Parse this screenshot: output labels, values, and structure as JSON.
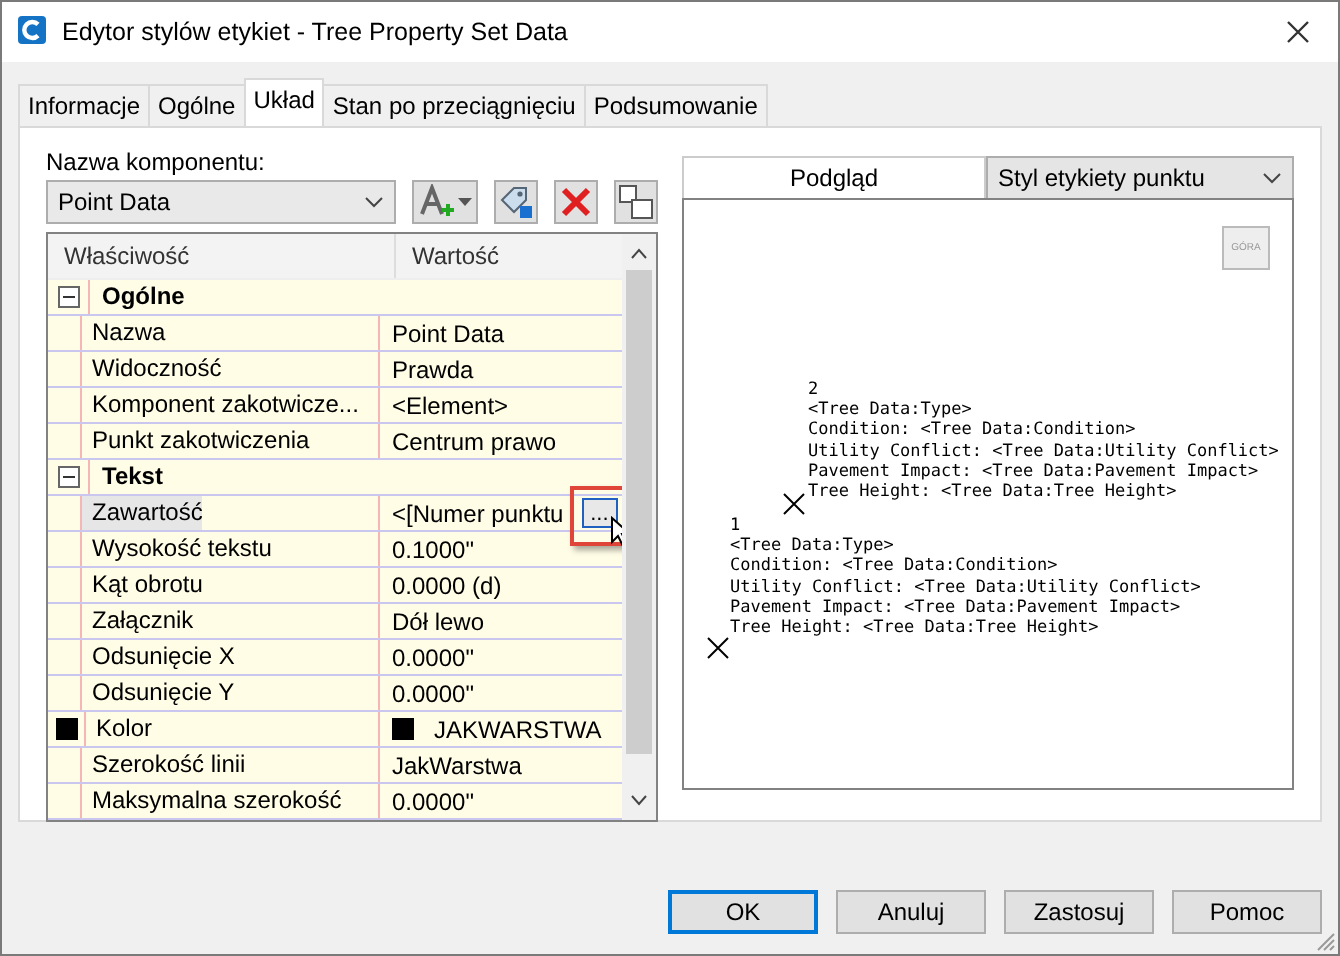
{
  "window": {
    "title": "Edytor stylów etykiet - Tree Property Set Data"
  },
  "tabs": [
    {
      "label": "Informacje",
      "selected": false
    },
    {
      "label": "Ogólne",
      "selected": false
    },
    {
      "label": "Układ",
      "selected": true
    },
    {
      "label": "Stan po przeciągnięciu",
      "selected": false
    },
    {
      "label": "Podsumowanie",
      "selected": false
    }
  ],
  "component": {
    "label": "Nazwa komponentu:",
    "value": "Point Data"
  },
  "grid": {
    "columns": [
      "Właściwość",
      "Wartość"
    ],
    "groups": [
      {
        "name": "Ogólne",
        "expanded": true,
        "rows": [
          {
            "name": "Nazwa",
            "value": "Point Data",
            "selected": false
          },
          {
            "name": "Widoczność",
            "value": "Prawda",
            "selected": false
          },
          {
            "name": "Komponent zakotwicze...",
            "value": "<Element>",
            "selected": false
          },
          {
            "name": "Punkt zakotwiczenia",
            "value": "Centrum prawo",
            "selected": false
          }
        ]
      },
      {
        "name": "Tekst",
        "expanded": true,
        "rows": [
          {
            "name": "Zawartość",
            "value": "<[Numer punktu",
            "selected": true,
            "button": "..."
          },
          {
            "name": "Wysokość tekstu",
            "value": "0.1000\"",
            "selected": false
          },
          {
            "name": "Kąt obrotu",
            "value": "0.0000 (d)",
            "selected": false
          },
          {
            "name": "Załącznik",
            "value": "Dół lewo",
            "selected": false
          },
          {
            "name": "Odsunięcie X",
            "value": "0.0000\"",
            "selected": false
          },
          {
            "name": "Odsunięcie Y",
            "value": "0.0000\"",
            "selected": false
          },
          {
            "name": "Kolor",
            "value": "JAKWARSTWA",
            "selected": false,
            "color": "#000000"
          },
          {
            "name": "Szerokość linii",
            "value": "JakWarstwa",
            "selected": false
          },
          {
            "name": "Maksymalna szerokość",
            "value": "0.0000\"",
            "selected": false
          }
        ]
      }
    ]
  },
  "preview": {
    "label": "Podgląd",
    "style": "Styl etykiety punktu",
    "view_button": "GÓRA",
    "labels": [
      {
        "lines": [
          "2",
          "<Tree Data:Type>",
          "Condition: <Tree Data:Condition>",
          "Utility Conflict: <Tree Data:Utility Conflict>",
          "Pavement Impact: <Tree Data:Pavement Impact>",
          "Tree Height: <Tree Data:Tree Height>"
        ]
      },
      {
        "lines": [
          "1",
          "<Tree Data:Type>",
          "Condition: <Tree Data:Condition>",
          "Utility Conflict: <Tree Data:Utility Conflict>",
          "Pavement Impact: <Tree Data:Pavement Impact>",
          "Tree Height: <Tree Data:Tree Height>"
        ]
      }
    ]
  },
  "buttons": [
    {
      "label": "OK",
      "default": true
    },
    {
      "label": "Anuluj",
      "default": false
    },
    {
      "label": "Zastosuj",
      "default": false
    },
    {
      "label": "Pomoc",
      "default": false
    }
  ]
}
